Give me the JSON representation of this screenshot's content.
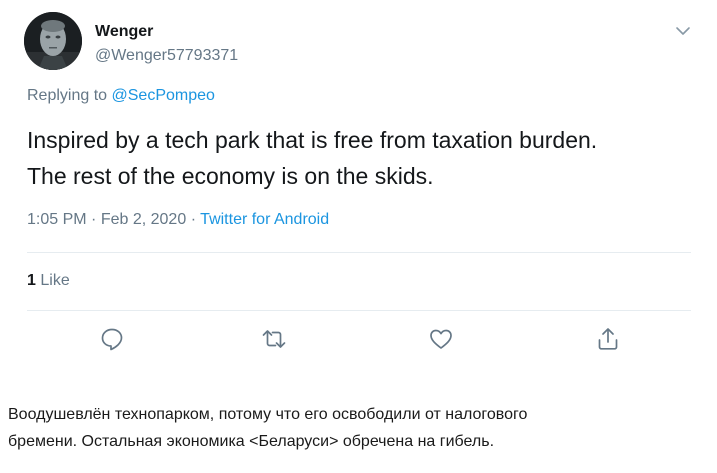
{
  "tweet": {
    "display_name": "Wenger",
    "handle": "@Wenger57793371",
    "replying_prefix": "Replying to",
    "replying_to": "@SecPompeo",
    "text_line1": "Inspired by a tech park that is free from taxation burden.",
    "text_line2": "The rest of the economy is on the skids.",
    "time": "1:05 PM",
    "date": "Feb 2, 2020",
    "source": "Twitter for Android",
    "like_count": "1",
    "like_label": "Like"
  },
  "icons": {
    "avatar": "avatar",
    "menu": "chevron-down-icon",
    "reply": "reply-icon",
    "retweet": "retweet-icon",
    "like": "heart-icon",
    "share": "share-icon"
  },
  "colors": {
    "link": "#1b95e0",
    "secondary_text": "#657786",
    "primary_text": "#14171a",
    "divider": "#e6ecf0"
  },
  "caption": {
    "line1": "Воодушевлён технопарком, потому что его освободили от налогового",
    "line2": "бремени. Остальная экономика <Беларуси> обречена на гибель."
  }
}
